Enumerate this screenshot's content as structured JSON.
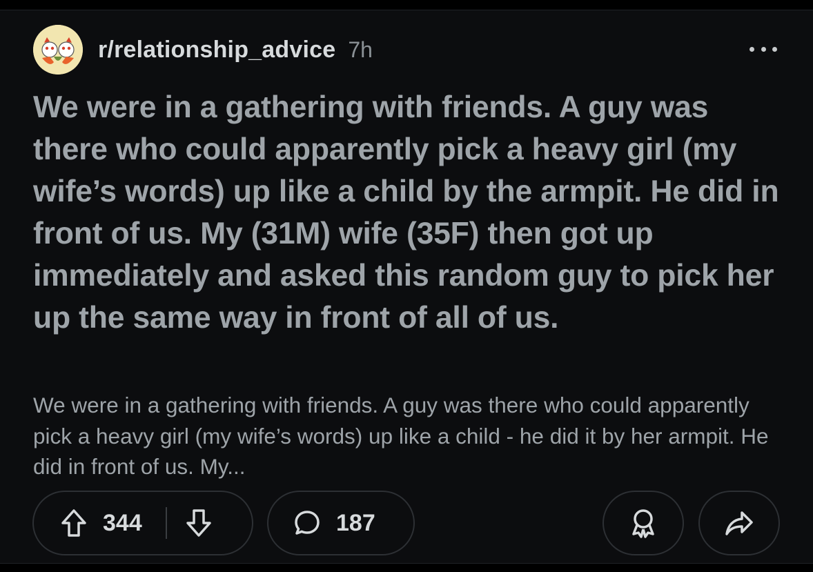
{
  "post": {
    "subreddit": "r/relationship_advice",
    "age": "7h",
    "title": "We were in a gathering with friends. A guy was there who could apparently pick a heavy girl (my wife’s words) up like a child by the armpit. He did in front of us. My (31M) wife (35F) then got up immediately and asked this random guy to pick her up the same way in front of all of us.",
    "body_preview": "We were in a gathering with friends. A guy was there who could apparently pick a heavy girl (my wife’s words) up like a child - he did it by her armpit. He did in front of us. My...",
    "upvotes": "344",
    "comments": "187"
  },
  "icons": {
    "avatar": "subreddit-avatar-icon",
    "more": "more-options-icon",
    "upvote": "upvote-arrow-icon",
    "downvote": "downvote-arrow-icon",
    "comment": "comment-bubble-icon",
    "award": "award-icon",
    "share": "share-arrow-icon"
  },
  "colors": {
    "background": "#000000",
    "card": "#0c0d0f",
    "title_text": "#9ea4a9",
    "count_text": "#d7dadc",
    "meta_text": "#8b9196",
    "pill_border": "#2d3034"
  }
}
